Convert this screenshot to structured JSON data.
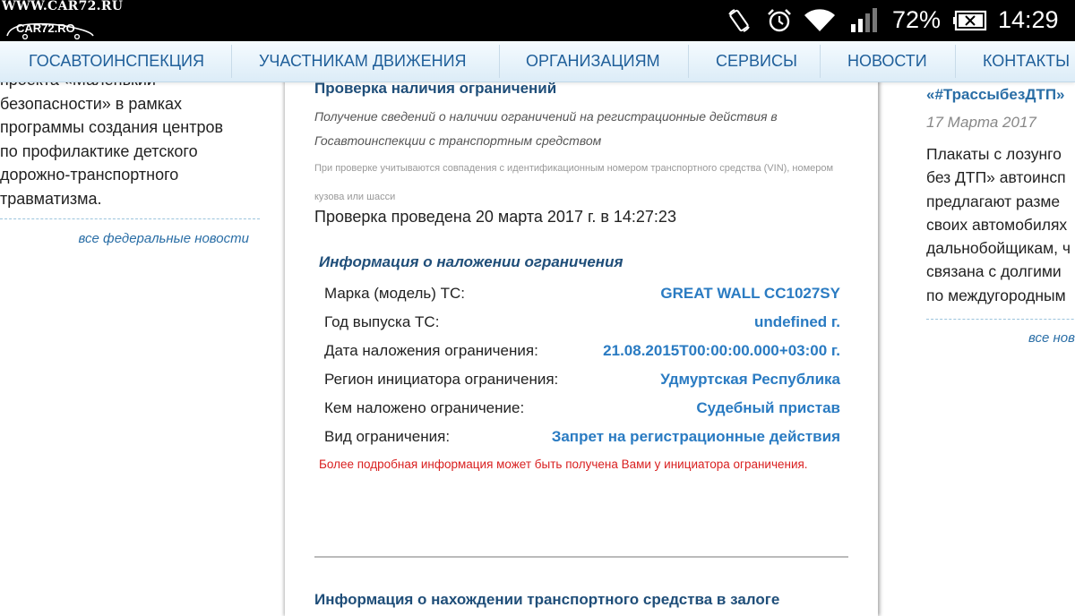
{
  "status_bar": {
    "watermark_top": "WWW.CAR72.RU",
    "watermark_logo": "CAR72.RO",
    "battery_percent": "72%",
    "time": "14:29",
    "icons": [
      "rotate-icon",
      "alarm-icon",
      "wifi-icon",
      "signal-icon",
      "battery-icon"
    ]
  },
  "nav": {
    "items": [
      {
        "label": "ГОСАВТОИНСПЕКЦИЯ"
      },
      {
        "label": "УЧАСТНИКАМ ДВИЖЕНИЯ"
      },
      {
        "label": "ОРГАНИЗАЦИЯМ"
      },
      {
        "label": "СЕРВИСЫ"
      },
      {
        "label": "НОВОСТИ"
      },
      {
        "label": "КОНТАКТЫ"
      }
    ]
  },
  "left_column": {
    "lines": [
      "проекта «Маленький",
      "безопасности» в рамках",
      "программы создания центров",
      "по профилактике детского",
      "дорожно-транспортного",
      "травматизма."
    ],
    "link": "все федеральные новости"
  },
  "main": {
    "section_title": "Проверка наличия ограничений",
    "description": "Получение сведений о наличии ограничений на регистрационные действия в Госавтоинспекции с транспортным средством",
    "note": "При проверке учитываются совпадения с идентификационным номером транспортного средства (VIN), номером кузова или шасси",
    "checked_at": "Проверка проведена 20 марта 2017 г. в 14:27:23",
    "info_title": "Информация о наложении ограничения",
    "rows": [
      {
        "label": "Марка (модель) ТС:",
        "value": "GREAT WALL CC1027SY"
      },
      {
        "label": "Год выпуска ТС:",
        "value": "undefined г."
      },
      {
        "label": "Дата наложения ограничения:",
        "value": "21.08.2015T00:00:00.000+03:00 г."
      },
      {
        "label": "Регион инициатора ограничения:",
        "value": "Удмуртская Республика"
      },
      {
        "label": "Кем наложено ограничение:",
        "value": "Судебный пристав"
      },
      {
        "label": "Вид ограничения:",
        "value": "Запрет на регистрационные действия"
      }
    ],
    "warning": "Более подробная информация может быть получена Вами у инициатора ограничения.",
    "next_section_title": "Информация о нахождении транспортного средства в залоге"
  },
  "right_column": {
    "news_title": "«#ТрассыбезДТП»",
    "news_date": "17 Марта 2017",
    "lines": [
      "Плакаты с лозунго",
      "без ДТП» автоинсп",
      "предлагают разме",
      "своих автомобилях",
      "дальнобойщикам, ч",
      "связана с долгими",
      "по междугородным"
    ],
    "link": "все нов"
  }
}
